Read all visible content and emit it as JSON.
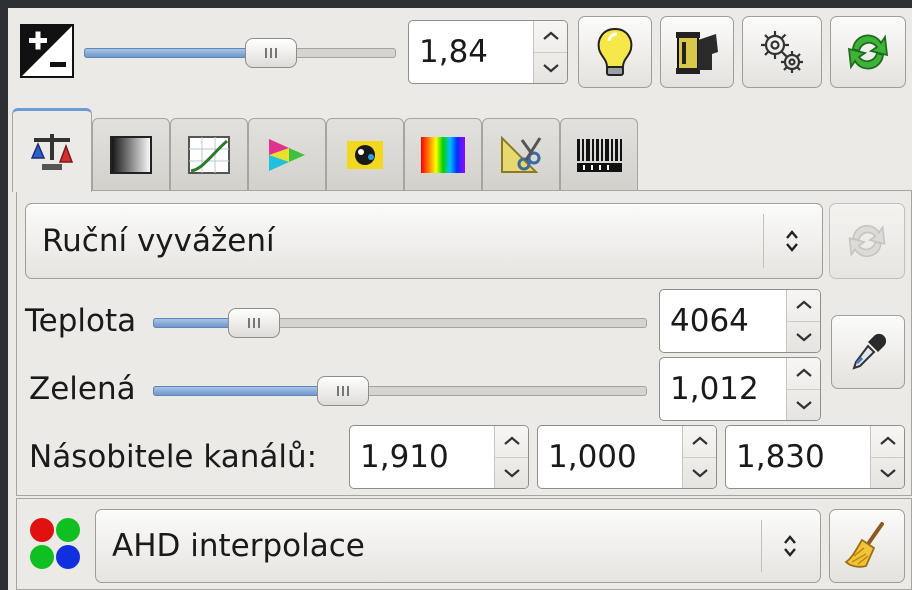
{
  "exposure": {
    "value": "1,84",
    "slider_fraction": 0.62
  },
  "toolbar": {
    "icons": [
      "auto-exposure-icon",
      "film-camera-icon",
      "gears-icon",
      "refresh-icon"
    ]
  },
  "tabs": [
    {
      "icon": "white-balance-icon",
      "active": true
    },
    {
      "icon": "grayscale-gradient-icon"
    },
    {
      "icon": "curves-icon"
    },
    {
      "icon": "color-triangle-icon"
    },
    {
      "icon": "lens-icon"
    },
    {
      "icon": "spectrum-icon"
    },
    {
      "icon": "crop-tools-icon"
    },
    {
      "icon": "exif-barcode-icon"
    }
  ],
  "white_balance": {
    "mode": "Ruční vyvážení",
    "temperature": {
      "label": "Teplota",
      "value": "4064",
      "slider_fraction": 0.17
    },
    "green": {
      "label": "Zelená",
      "value": "1,012",
      "slider_fraction": 0.37
    },
    "multipliers": {
      "label": "Násobitele kanálů:",
      "values": [
        "1,910",
        "1,000",
        "1,830"
      ]
    }
  },
  "interpolation": {
    "mode": "AHD interpolace"
  },
  "colors": {
    "accent": "#6e9bd6",
    "slider_fill": "#6f97c9",
    "background": "#eceae6",
    "frame": "#2e3134"
  }
}
